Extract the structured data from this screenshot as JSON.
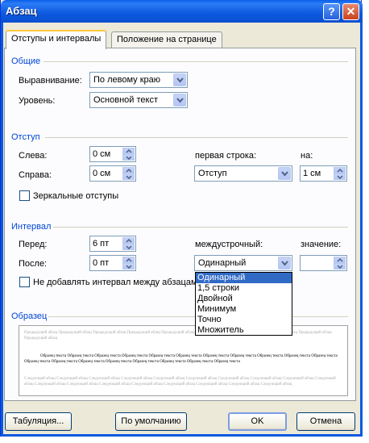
{
  "window": {
    "title": "Абзац",
    "help": "?",
    "close": "✕"
  },
  "tabs": [
    {
      "label": "Отступы и интервалы",
      "active": true
    },
    {
      "label": "Положение на странице",
      "active": false
    }
  ],
  "general": {
    "legend": "Общие",
    "alignment_label": "Выравнивание:",
    "alignment_value": "По левому краю",
    "level_label": "Уровень:",
    "level_value": "Основной текст"
  },
  "indent": {
    "legend": "Отступ",
    "left_label": "Слева:",
    "left_value": "0 см",
    "right_label": "Справа:",
    "right_value": "0 см",
    "first_line_label": "первая строка:",
    "first_line_value": "Отступ",
    "by_label": "на:",
    "by_value": "1 см",
    "mirror_label": "Зеркальные отступы"
  },
  "spacing": {
    "legend": "Интервал",
    "before_label": "Перед:",
    "before_value": "6 пт",
    "after_label": "После:",
    "after_value": "0 пт",
    "line_label": "междустрочный:",
    "line_value": "Одинарный",
    "at_label": "значение:",
    "at_value": "",
    "no_space_label": "Не добавлять интервал между абзацами"
  },
  "line_spacing_options": [
    "Одинарный",
    "1,5 строки",
    "Двойной",
    "Минимум",
    "Точно",
    "Множитель"
  ],
  "preview": {
    "legend": "Образец",
    "prev_text": "Предыдущий абзац Предыдущий абзац Предыдущий абзац Предыдущий абзац Предыдущий абзац Предыдущий абзац Предыдущий абзац Предыдущий абзац Предыдущий абзац Предыдущий абзац",
    "sample_text": "Образец текста Образец текста Образец текста Образец текста Образец текста Образец текста Образец текста Образец текста Образец текста Образец текста Образец текста Образец текста Образец текста Образец текста Образец текста Образец текста Образец текста Образец текста Образец текста",
    "next_text": "Следующий абзац Следующий абзац Следующий абзац Следующий абзац Следующий абзац Следующий абзац Следующий абзац Следующий абзац Следующий абзац Следующий абзац Следующий абзац Следующий абзац Следующий абзац Следующий абзац Следующий абзац Следующий абзац Следующий абзац Следующий абзац"
  },
  "buttons": {
    "tabs": "Табуляция...",
    "default": "По умолчанию",
    "ok": "OK",
    "cancel": "Отмена"
  },
  "colors": {
    "titlebar": "#0a5ee8",
    "group_label": "#0046d5",
    "selection": "#316ac5"
  }
}
